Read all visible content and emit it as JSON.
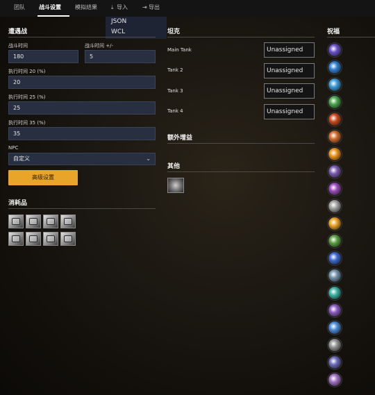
{
  "nav": {
    "tabs": [
      {
        "label": "团队",
        "icon": ""
      },
      {
        "label": "战斗设置",
        "icon": ""
      },
      {
        "label": "模拟结果",
        "icon": ""
      },
      {
        "label": "导入",
        "icon": "download-icon"
      },
      {
        "label": "导出",
        "icon": "export-icon"
      }
    ],
    "active_tab": "战斗设置",
    "import_menu": [
      "JSON",
      "WCL"
    ]
  },
  "encounter": {
    "title": "遭遇战",
    "duration_label": "战斗时间",
    "duration_value": "180",
    "variation_label": "战斗时间 +/-",
    "variation_value": "5",
    "exec20_label": "执行时间 20 (%)",
    "exec20_value": "20",
    "exec25_label": "执行时间 25 (%)",
    "exec25_value": "25",
    "exec35_label": "执行时间 35 (%)",
    "exec35_value": "35",
    "npc_label": "NPC",
    "npc_value": "自定义",
    "advanced_button": "高级设置"
  },
  "consumables": {
    "title": "消耗品",
    "count": 8
  },
  "tanks": {
    "title": "坦克",
    "rows": [
      {
        "label": "Main Tank",
        "value": "Unassigned"
      },
      {
        "label": "Tank 2",
        "value": "Unassigned"
      },
      {
        "label": "Tank 3",
        "value": "Unassigned"
      },
      {
        "label": "Tank 4",
        "value": "Unassigned"
      }
    ]
  },
  "external_buffs": {
    "title": "额外增益"
  },
  "other": {
    "title": "其他"
  },
  "blessings": {
    "title": "祝福",
    "colors": [
      "#6a4fc8",
      "#2f7fd0",
      "#3a9ad8",
      "#4aa64a",
      "#c84a1a",
      "#d06a2a",
      "#e8901a",
      "#7a5ab0",
      "#9a4ab8",
      "#a0a0a0",
      "#e8a020",
      "#5aa040",
      "#3a6ad0",
      "#7090a8",
      "#3ab0a0",
      "#8a5ac0",
      "#4a8ad8",
      "#909090",
      "#6a6ab8",
      "#a070c0"
    ]
  }
}
